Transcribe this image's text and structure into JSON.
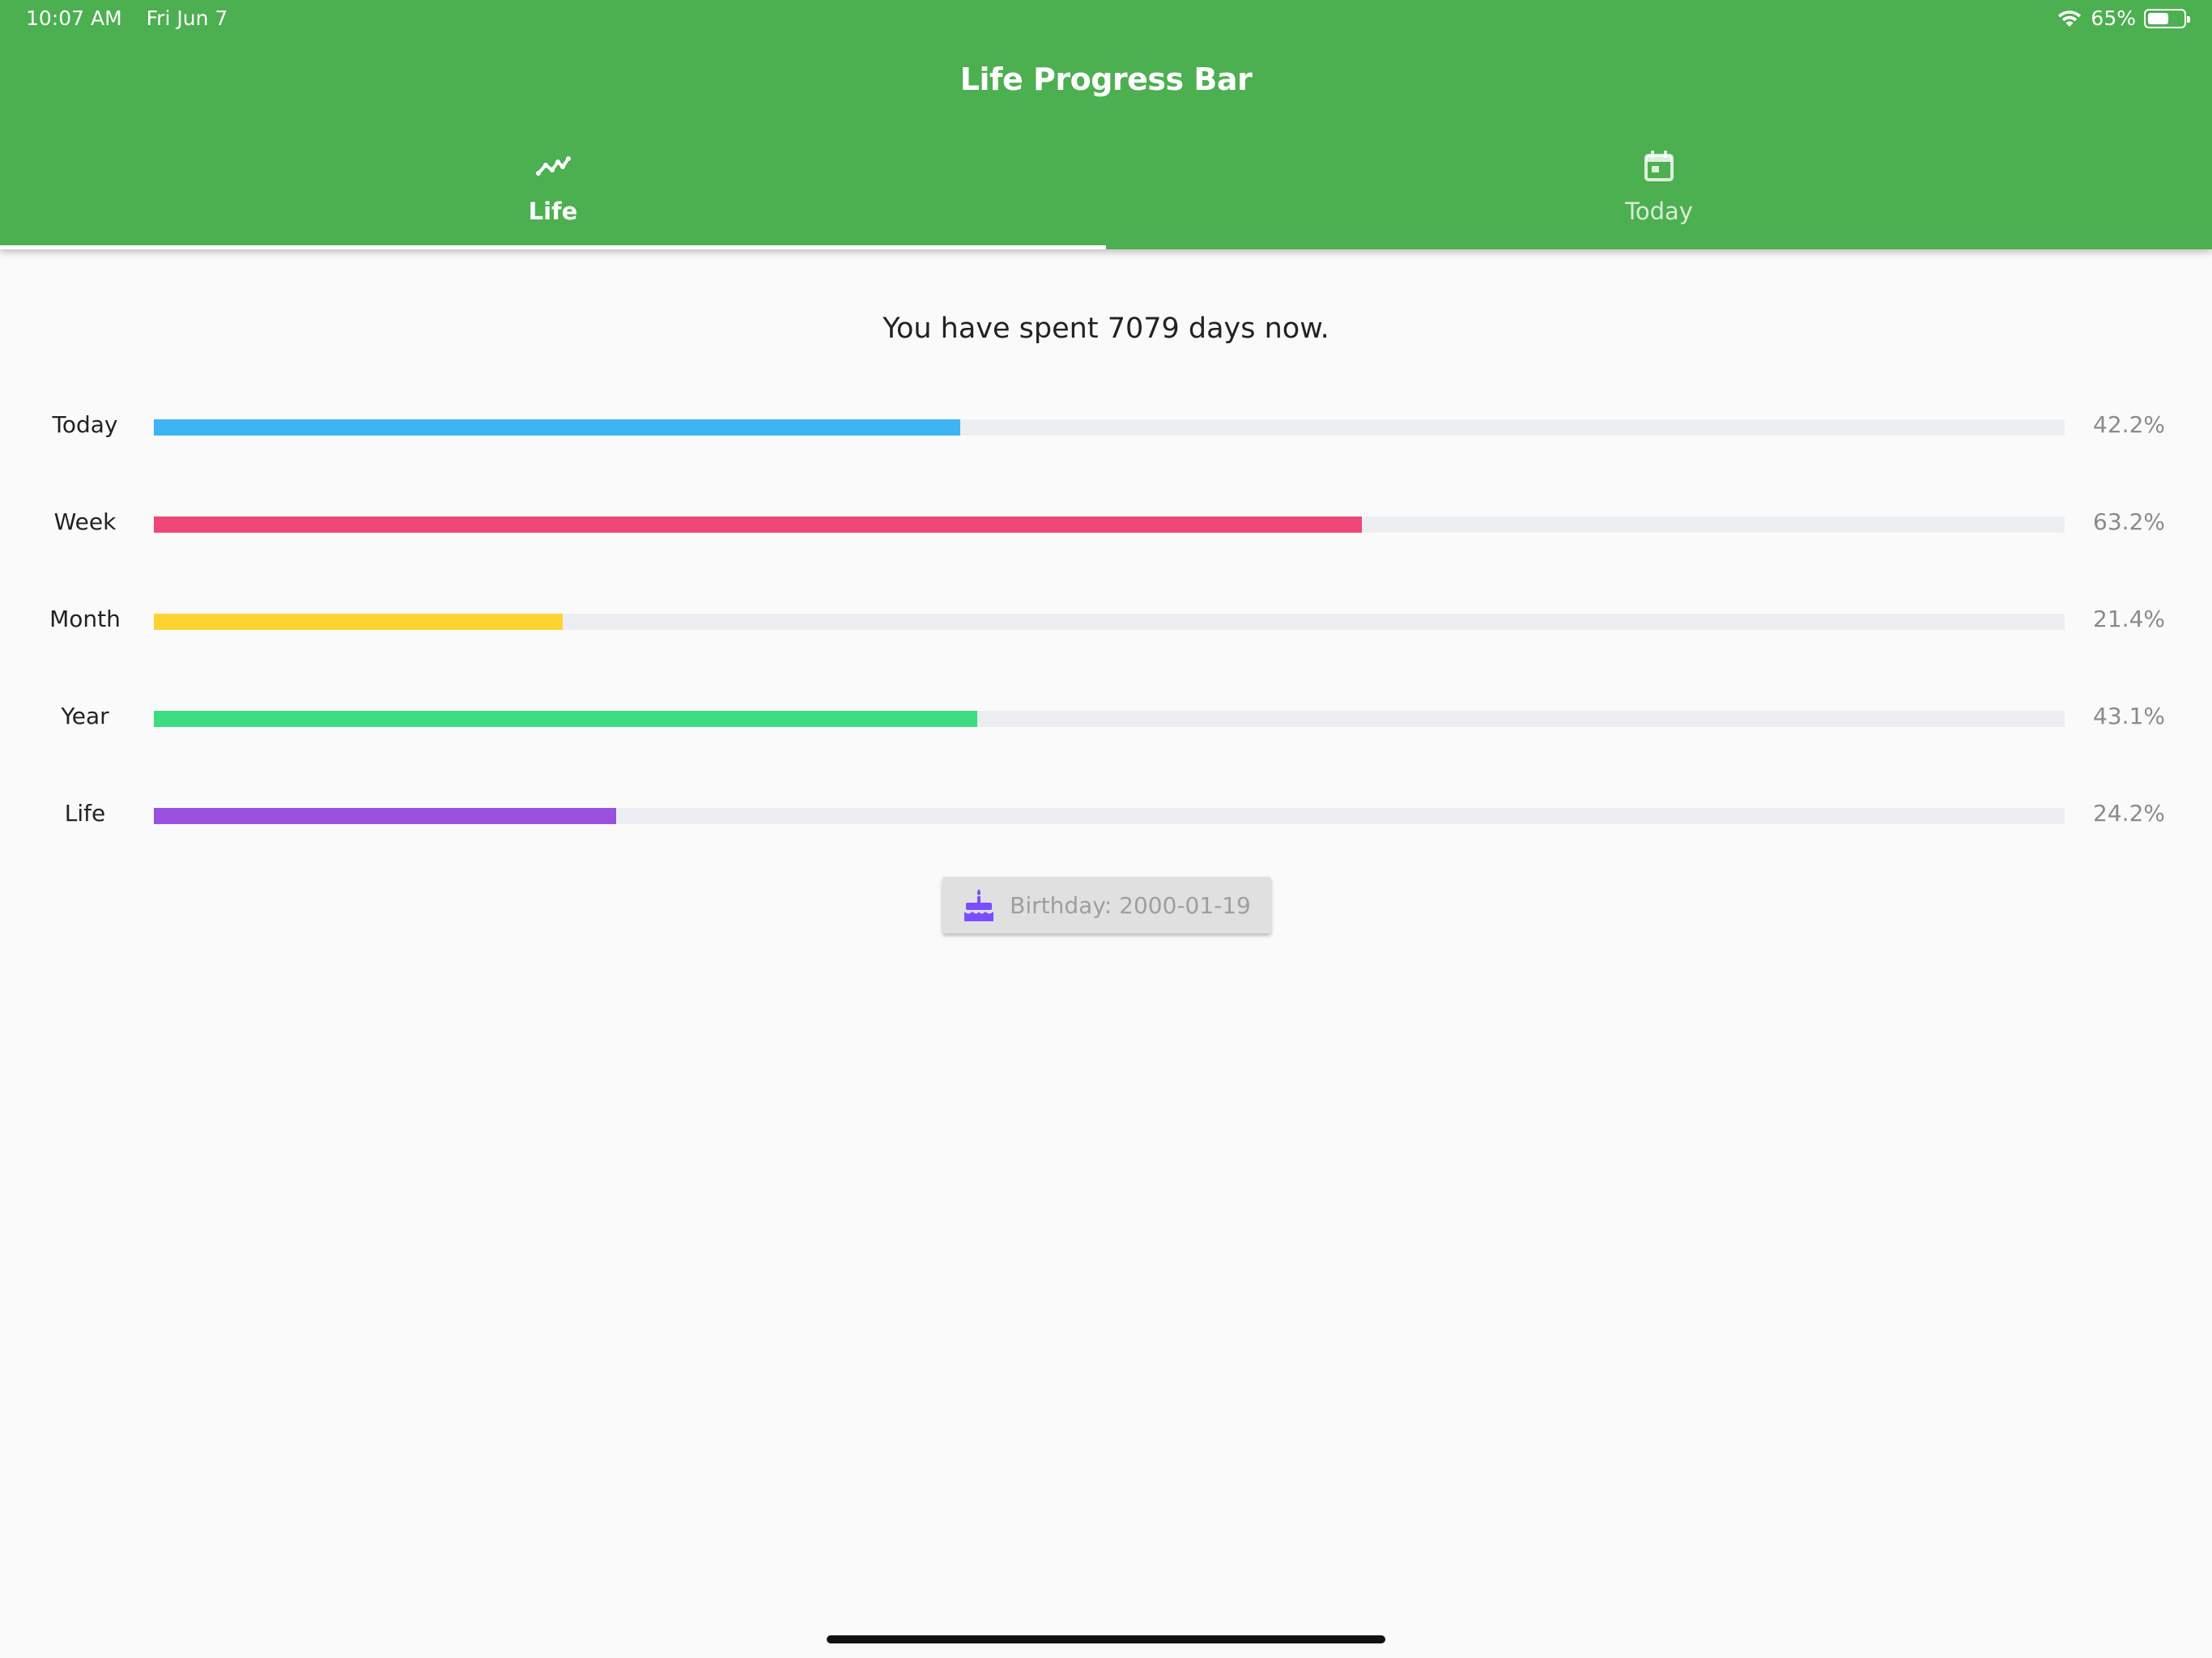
{
  "status_bar": {
    "time": "10:07 AM",
    "date": "Fri Jun 7",
    "battery": "65%",
    "battery_level": 0.65,
    "icons": [
      "wifi-icon",
      "battery-icon"
    ]
  },
  "app": {
    "title": "Life Progress Bar",
    "primary_color": "#4caf50"
  },
  "tabs": [
    {
      "label": "Life",
      "icon": "trending-up-icon",
      "active": true
    },
    {
      "label": "Today",
      "icon": "calendar-icon",
      "active": false
    }
  ],
  "summary": "You have spent 7079 days now.",
  "progress": [
    {
      "label": "Today",
      "percent_text": "42.2%",
      "value": 42.2,
      "color": "#3db5f4"
    },
    {
      "label": "Week",
      "percent_text": "63.2%",
      "value": 63.2,
      "color": "#ee4777"
    },
    {
      "label": "Month",
      "percent_text": "21.4%",
      "value": 21.4,
      "color": "#fdd330"
    },
    {
      "label": "Year",
      "percent_text": "43.1%",
      "value": 43.1,
      "color": "#3ddc84"
    },
    {
      "label": "Life",
      "percent_text": "24.2%",
      "value": 24.2,
      "color": "#9b51e0"
    }
  ],
  "birthday_button": {
    "label": "Birthday: 2000-01-19",
    "icon": "cake-icon",
    "icon_color": "#7c4dff"
  }
}
